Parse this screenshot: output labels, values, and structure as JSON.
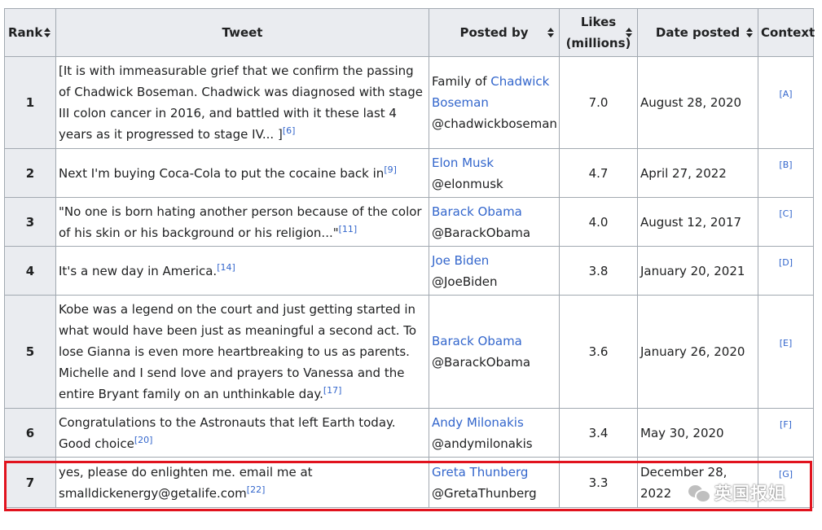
{
  "table": {
    "headers": {
      "rank": "Rank",
      "tweet": "Tweet",
      "posted_by": "Posted by",
      "likes_line1": "Likes",
      "likes_line2": "(millions)",
      "date": "Date posted",
      "context": "Context"
    },
    "rows": [
      {
        "rank": "1",
        "tweet": "[It is with immeasurable grief that we confirm the passing of Chadwick Boseman. Chadwick was diagnosed with stage III colon cancer in 2016, and battled with it these last 4 years as it progressed to stage IV... ]",
        "tweet_ref": "[6]",
        "poster_prefix": "Family of ",
        "poster_name": "Chadwick Boseman",
        "handle": "@chadwickboseman",
        "likes": "7.0",
        "date": "August 28, 2020",
        "context": "[A]"
      },
      {
        "rank": "2",
        "tweet": "Next I'm buying Coca-Cola to put the cocaine back in",
        "tweet_ref": "[9]",
        "poster_prefix": "",
        "poster_name": "Elon Musk",
        "handle": "@elonmusk",
        "likes": "4.7",
        "date": "April 27, 2022",
        "context": "[B]"
      },
      {
        "rank": "3",
        "tweet": "\"No one is born hating another person because of the color of his skin or his background or his religion...\"",
        "tweet_ref": "[11]",
        "poster_prefix": "",
        "poster_name": "Barack Obama",
        "handle": "@BarackObama",
        "likes": "4.0",
        "date": "August 12, 2017",
        "context": "[C]"
      },
      {
        "rank": "4",
        "tweet": "It's a new day in America.",
        "tweet_ref": "[14]",
        "poster_prefix": "",
        "poster_name": "Joe Biden",
        "handle": "@JoeBiden",
        "likes": "3.8",
        "date": "January 20, 2021",
        "context": "[D]"
      },
      {
        "rank": "5",
        "tweet": "Kobe was a legend on the court and just getting started in what would have been just as meaningful a second act. To lose Gianna is even more heartbreaking to us as parents. Michelle and I send love and prayers to Vanessa and the entire Bryant family on an unthinkable day.",
        "tweet_ref": "[17]",
        "poster_prefix": "",
        "poster_name": "Barack Obama",
        "handle": "@BarackObama",
        "likes": "3.6",
        "date": "January 26, 2020",
        "context": "[E]"
      },
      {
        "rank": "6",
        "tweet": "Congratulations to the Astronauts that left Earth today. Good choice",
        "tweet_ref": "[20]",
        "poster_prefix": "",
        "poster_name": "Andy Milonakis",
        "handle": "@andymilonakis",
        "likes": "3.4",
        "date": "May 30, 2020",
        "context": "[F]"
      },
      {
        "rank": "7",
        "tweet": "yes, please do enlighten me. email me at smalldickenergy@getalife.com",
        "tweet_ref": "[22]",
        "poster_prefix": "",
        "poster_name": "Greta Thunberg",
        "handle": "@GretaThunberg",
        "likes": "3.3",
        "date": "December 28, 2022",
        "context": "[G]"
      }
    ]
  },
  "highlight_color": "#e1131e",
  "link_color": "#3366cc",
  "header_bg": "#eaecf0",
  "watermark": {
    "icon": "wechat-icon",
    "text": "英国报姐"
  }
}
